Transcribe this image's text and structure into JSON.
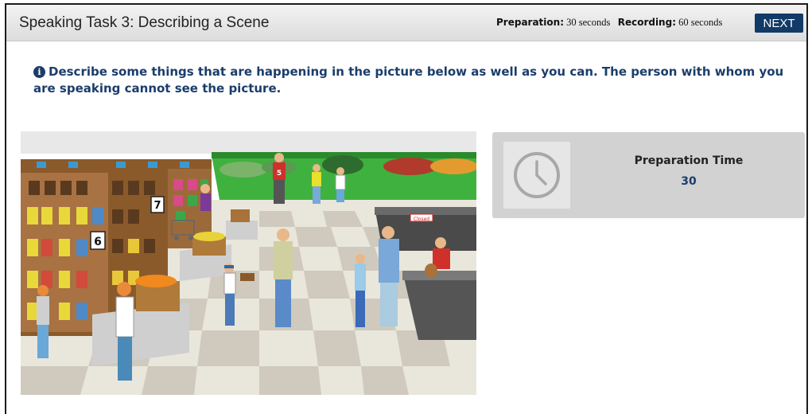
{
  "header": {
    "title": "Speaking Task 3: Describing a Scene",
    "preparation_label": "Preparation:",
    "preparation_value": "30 seconds",
    "recording_label": "Recording:",
    "recording_value": "60 seconds",
    "next_label": "NEXT"
  },
  "instruction": {
    "icon": "info-icon",
    "text": "Describe some things that are happening in the picture below as well as you can. The person with whom you are speaking cannot see the picture."
  },
  "scene": {
    "aisle_numbers": [
      "7",
      "6"
    ],
    "jersey_number": "5",
    "closed_sign": "Closed"
  },
  "prep_timer": {
    "icon": "clock-icon",
    "label": "Preparation Time",
    "value": "30"
  },
  "colors": {
    "accent": "#123a66",
    "text_blue": "#1b3d6b",
    "panel_gray": "#d2d2d2"
  }
}
